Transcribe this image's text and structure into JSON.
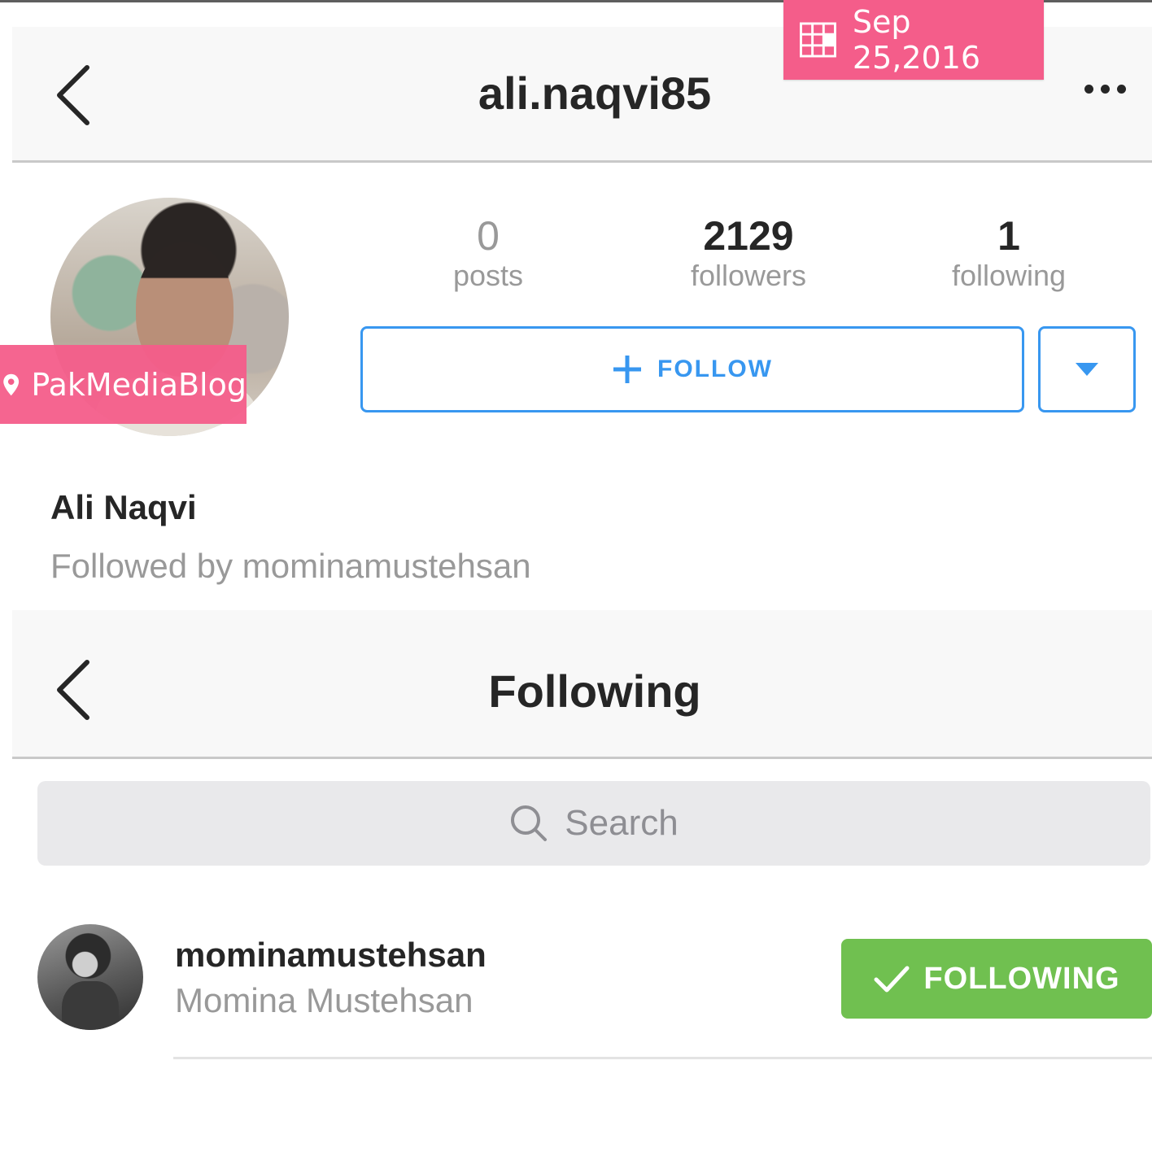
{
  "watermark": {
    "date": "Sep 25,2016",
    "source": "PakMediaBlog",
    "badge_color": "#f45d8a",
    "date_icon": "calendar-icon",
    "source_icon": "location-pin-icon"
  },
  "profile": {
    "header": {
      "title": "ali.naqvi85",
      "back_icon": "chevron-left-icon",
      "more_icon": "more-horizontal-icon"
    },
    "stats": [
      {
        "value": "0",
        "label": "posts"
      },
      {
        "value": "2129",
        "label": "followers"
      },
      {
        "value": "1",
        "label": "following"
      }
    ],
    "follow_button": {
      "label": "FOLLOW",
      "icon": "plus-icon",
      "color": "#3897f0"
    },
    "dropdown_icon": "triangle-down-icon",
    "full_name": "Ali Naqvi",
    "followed_by": "Followed by mominamustehsan"
  },
  "following_screen": {
    "header": {
      "title": "Following",
      "back_icon": "chevron-left-icon"
    },
    "search": {
      "placeholder": "Search",
      "icon": "search-icon"
    },
    "users": [
      {
        "handle": "mominamustehsan",
        "name": "Momina Mustehsan",
        "button_label": "FOLLOWING",
        "button_icon": "checkmark-icon",
        "button_color": "#70c050"
      }
    ]
  }
}
